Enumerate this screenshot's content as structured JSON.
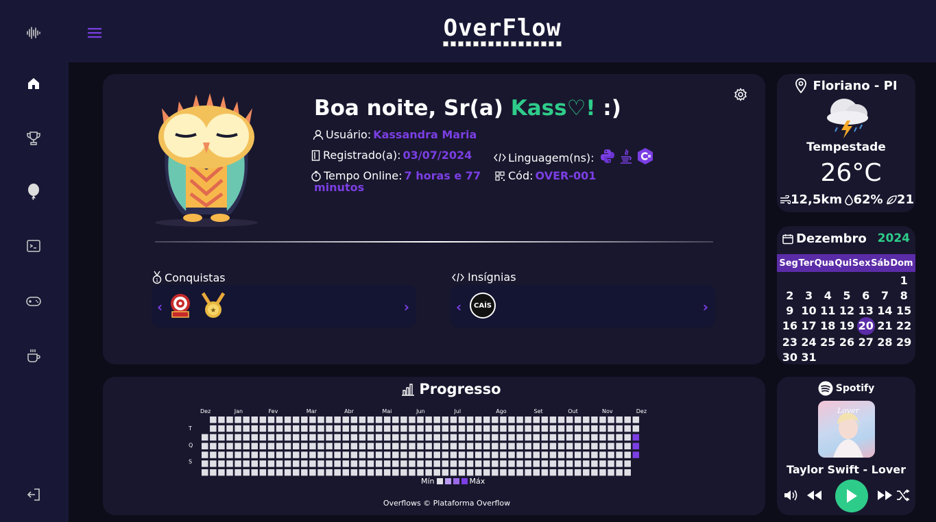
{
  "app": {
    "logo_text": "OverFlow"
  },
  "sidebar": {
    "items": [
      {
        "icon": "audio-wave-icon"
      },
      {
        "icon": "home-icon"
      },
      {
        "icon": "trophy-icon"
      },
      {
        "icon": "balloon-icon"
      },
      {
        "icon": "terminal-icon"
      },
      {
        "icon": "gamepad-icon"
      },
      {
        "icon": "coffee-icon"
      },
      {
        "icon": "logout-icon"
      }
    ]
  },
  "profile": {
    "greeting_prefix": "Boa noite, Sr(a) ",
    "greeting_name": "Kass♡!",
    "greeting_suffix": " :)",
    "user_label": "Usuário:",
    "user_value": "Kassandra Maria",
    "registered_label": "Registrado(a):",
    "registered_value": "03/07/2024",
    "online_label": "Tempo Online:",
    "online_value_1": "7 horas e 77",
    "online_value_2": "minutos",
    "languages_label": "Linguagem(ns):",
    "languages": [
      "python-icon",
      "java-icon",
      "csharp-icon"
    ],
    "code_label": "Cód:",
    "code_value": "OVER-001",
    "achievements_title": "Conquistas",
    "badges_title": "Insígnias",
    "badge_logo_text": "CAÍS"
  },
  "weather": {
    "location": "Floriano - PI",
    "condition": "Tempestade",
    "temperature": "26°C",
    "wind": "12,5km",
    "humidity": "62%",
    "index": "21"
  },
  "calendar": {
    "month": "Dezembro",
    "year": "2024",
    "weekdays": [
      "Seg",
      "Ter",
      "Qua",
      "Qui",
      "Sex",
      "Sáb",
      "Dom"
    ],
    "leading_blanks": 6,
    "days_in_month": 31,
    "today": 20
  },
  "progress": {
    "title": "Progresso",
    "months": [
      "Dez",
      "Jan",
      "Fev",
      "Mar",
      "Abr",
      "Mai",
      "Jun",
      "Jul",
      "Ago",
      "Set",
      "Out",
      "Nov",
      "Dez"
    ],
    "row_labels": [
      "",
      "T",
      "",
      "Q",
      "",
      "S",
      ""
    ],
    "legend_min": "Mín",
    "legend_max": "Máx",
    "footer": "Overflows © Plataforma Overflow",
    "weeks": 53,
    "active_cells": [
      {
        "week": 52,
        "day": 2,
        "level": 3
      },
      {
        "week": 52,
        "day": 3,
        "level": 3
      },
      {
        "week": 52,
        "day": 4,
        "level": 3
      }
    ],
    "colors": {
      "empty": "#e0dfe6",
      "l1": "#b99cf2",
      "l2": "#9b6ae8",
      "l3": "#7b3fe4"
    }
  },
  "spotify": {
    "brand": "Spotify",
    "track": "Taylor Swift - Lover",
    "cover_text": "Lover"
  },
  "colors": {
    "accent_purple": "#7b3fe4",
    "accent_green": "#2ecc8a",
    "card_bg": "#19172e",
    "nav_bg": "#181836"
  }
}
